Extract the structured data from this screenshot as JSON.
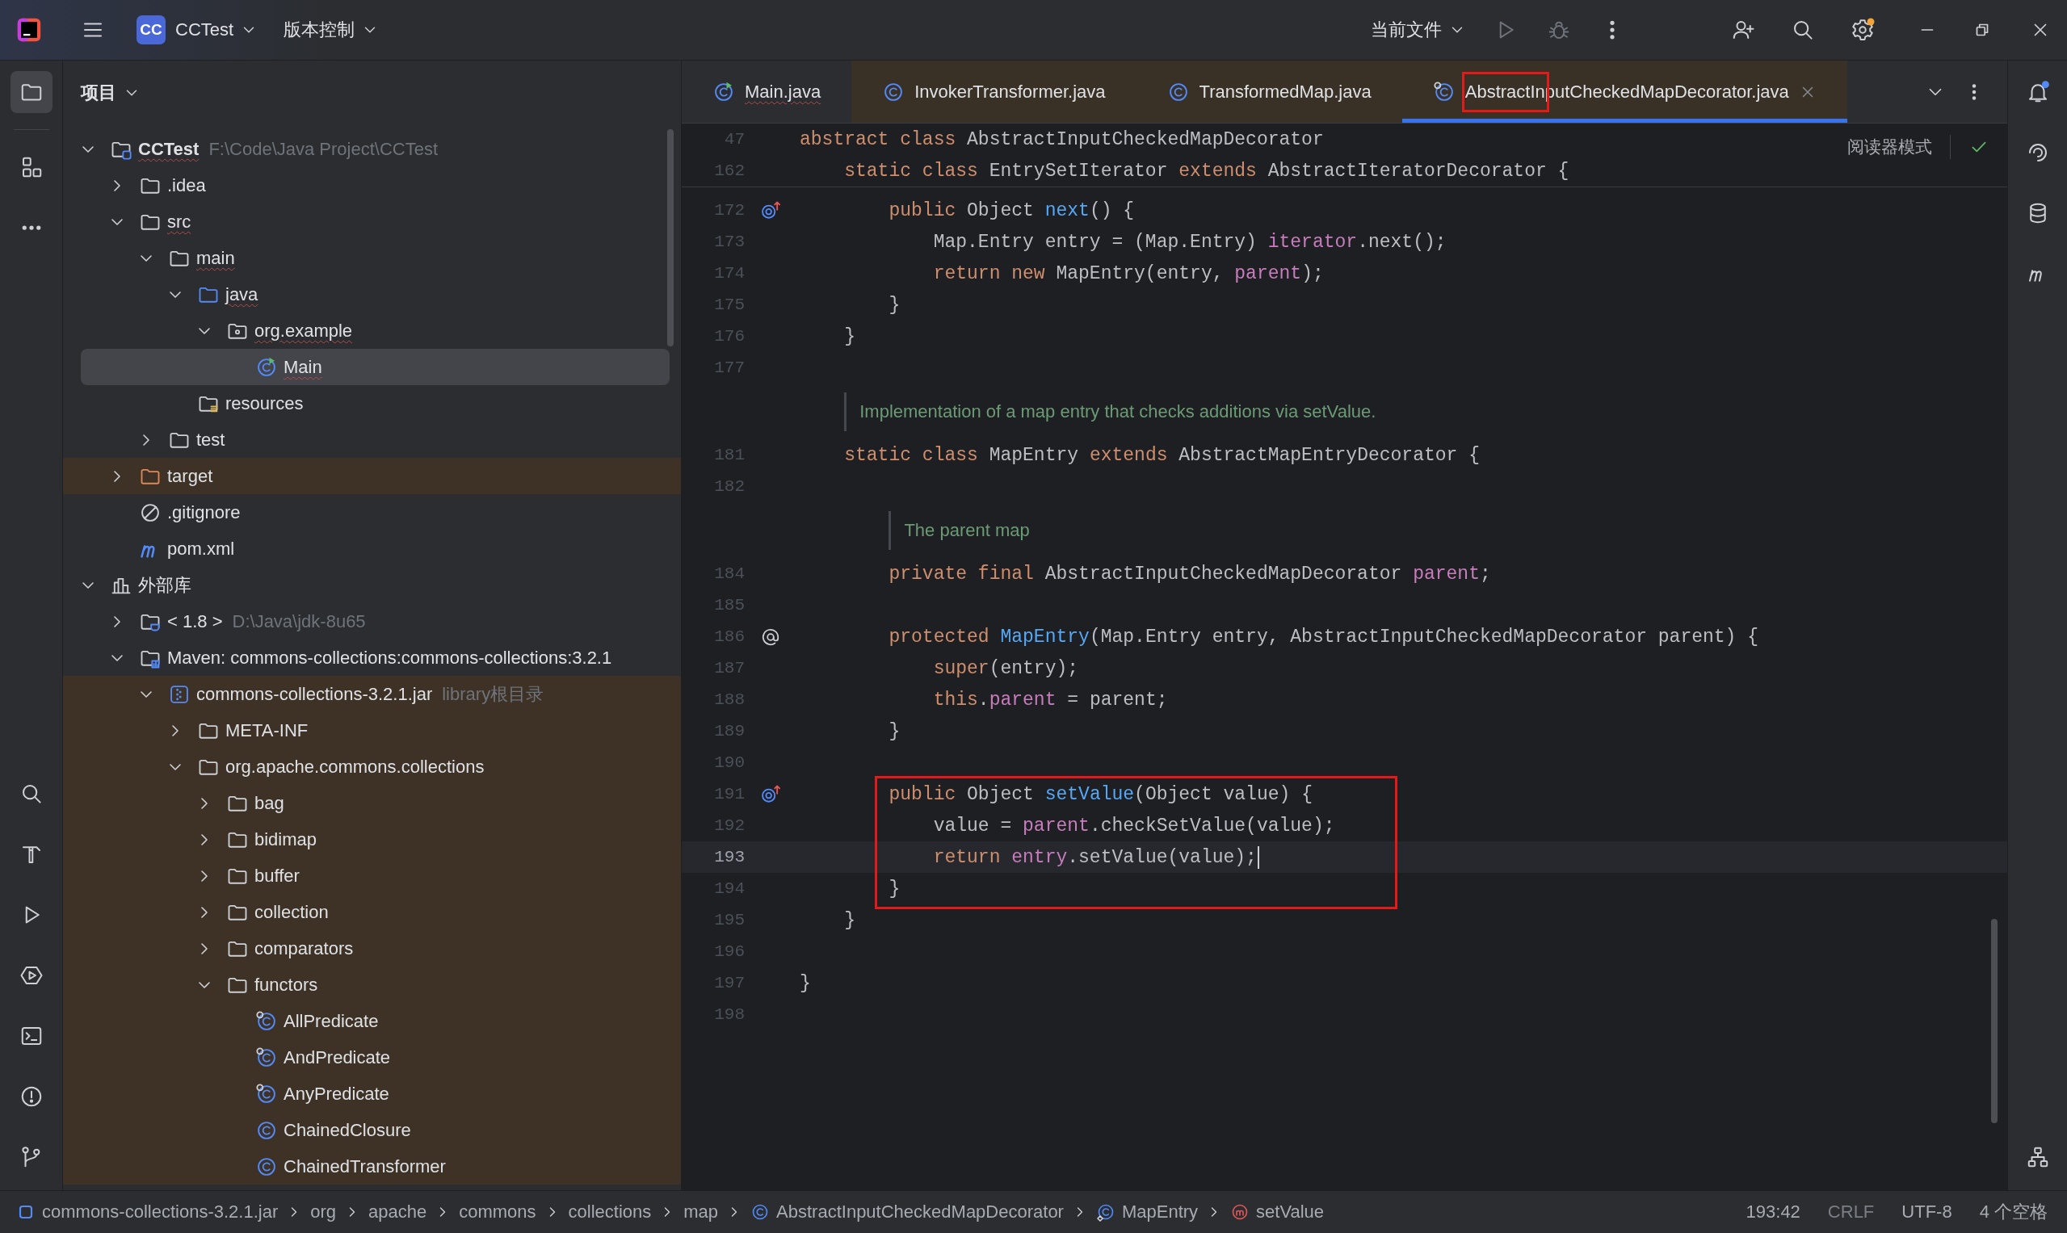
{
  "topbar": {
    "project_badge": "CC",
    "project": "CCTest",
    "vcs": "版本控制",
    "run_config": "当前文件",
    "run_enabled": false,
    "debug_enabled": false,
    "settings_badge": true
  },
  "left_tools": {
    "top": [
      {
        "kind": "project",
        "selected": true
      },
      {
        "kind": "structure",
        "selected": false
      },
      {
        "kind": "more",
        "selected": false
      }
    ],
    "bottom": [
      {
        "kind": "search",
        "selected": false
      },
      {
        "kind": "build",
        "selected": false
      },
      {
        "kind": "run",
        "selected": false
      },
      {
        "kind": "services",
        "selected": false
      },
      {
        "kind": "terminal",
        "selected": false
      },
      {
        "kind": "problems",
        "selected": false
      },
      {
        "kind": "git",
        "selected": false
      }
    ]
  },
  "project_panel": {
    "title": "项目",
    "tree": [
      {
        "name": "CCTest",
        "kind": "project",
        "hint": "F:\\Code\\Java Project\\CCTest",
        "expanded": true,
        "selected": false,
        "squiggly": true,
        "children": [
          {
            "name": ".idea",
            "kind": "folder",
            "expanded": false,
            "selected": false,
            "squiggly": false
          },
          {
            "name": "src",
            "kind": "folder",
            "expanded": true,
            "selected": false,
            "squiggly": true,
            "children": [
              {
                "name": "main",
                "kind": "folder",
                "expanded": true,
                "selected": false,
                "squiggly": true,
                "children": [
                  {
                    "name": "java",
                    "kind": "source_root",
                    "expanded": true,
                    "selected": false,
                    "squiggly": true,
                    "children": [
                      {
                        "name": "org.example",
                        "kind": "package",
                        "expanded": true,
                        "selected": false,
                        "squiggly": true,
                        "children": [
                          {
                            "name": "Main",
                            "kind": "class_main",
                            "selected": true,
                            "squiggly": true
                          }
                        ]
                      }
                    ]
                  },
                  {
                    "name": "resources",
                    "kind": "resources",
                    "selected": false,
                    "squiggly": false
                  }
                ]
              },
              {
                "name": "test",
                "kind": "folder",
                "expanded": false,
                "selected": false,
                "squiggly": false
              }
            ]
          },
          {
            "name": "target",
            "kind": "excluded",
            "expanded": false,
            "selected": false,
            "squiggly": false
          },
          {
            "name": ".gitignore",
            "kind": "ignore_file",
            "selected": false,
            "squiggly": false
          },
          {
            "name": "pom.xml",
            "kind": "maven_file",
            "selected": false,
            "squiggly": false
          }
        ]
      },
      {
        "name": "外部库",
        "kind": "libraries",
        "expanded": true,
        "selected": false,
        "squiggly": false,
        "children": [
          {
            "name": "< 1.8 >",
            "kind": "sdk",
            "hint": "D:\\Java\\jdk-8u65",
            "expanded": false,
            "selected": false,
            "squiggly": false
          },
          {
            "name": "Maven: commons-collections:commons-collections:3.2.1",
            "kind": "maven_lib",
            "expanded": true,
            "selected": false,
            "squiggly": false,
            "children": [
              {
                "name": "commons-collections-3.2.1.jar",
                "kind": "jar",
                "hint": "library根目录",
                "expanded": true,
                "selected": false,
                "squiggly": false,
                "children": [
                  {
                    "name": "META-INF",
                    "kind": "folder",
                    "expanded": false,
                    "selected": false,
                    "squiggly": false
                  },
                  {
                    "name": "org.apache.commons.collections",
                    "kind": "folder",
                    "expanded": true,
                    "selected": false,
                    "squiggly": false,
                    "children": [
                      {
                        "name": "bag",
                        "kind": "folder",
                        "expanded": false,
                        "selected": false,
                        "squiggly": false
                      },
                      {
                        "name": "bidimap",
                        "kind": "folder",
                        "expanded": false,
                        "selected": false,
                        "squiggly": false
                      },
                      {
                        "name": "buffer",
                        "kind": "folder",
                        "expanded": false,
                        "selected": false,
                        "squiggly": false
                      },
                      {
                        "name": "collection",
                        "kind": "folder",
                        "expanded": false,
                        "selected": false,
                        "squiggly": false
                      },
                      {
                        "name": "comparators",
                        "kind": "folder",
                        "expanded": false,
                        "selected": false,
                        "squiggly": false
                      },
                      {
                        "name": "functors",
                        "kind": "folder",
                        "expanded": true,
                        "selected": false,
                        "squiggly": false,
                        "children": [
                          {
                            "name": "AllPredicate",
                            "kind": "class_lib",
                            "selected": false,
                            "squiggly": false
                          },
                          {
                            "name": "AndPredicate",
                            "kind": "class_lib",
                            "selected": false,
                            "squiggly": false
                          },
                          {
                            "name": "AnyPredicate",
                            "kind": "class_lib",
                            "selected": false,
                            "squiggly": false
                          },
                          {
                            "name": "ChainedClosure",
                            "kind": "class",
                            "selected": false,
                            "squiggly": false
                          },
                          {
                            "name": "ChainedTransformer",
                            "kind": "class",
                            "selected": false,
                            "squiggly": false
                          }
                        ]
                      }
                    ]
                  }
                ]
              }
            ]
          }
        ]
      }
    ]
  },
  "editor": {
    "tabs": [
      {
        "label": "Main.java",
        "kind": "class_main",
        "selected": false,
        "library": false,
        "squiggly": true,
        "boxed": false
      },
      {
        "label": "InvokerTransformer.java",
        "kind": "class",
        "selected": false,
        "library": true,
        "squiggly": false,
        "boxed": false
      },
      {
        "label": "TransformedMap.java",
        "kind": "class",
        "selected": false,
        "library": true,
        "squiggly": false,
        "boxed": false
      },
      {
        "label": "AbstractInputCheckedMapDecorator.java",
        "kind": "class_lib",
        "selected": true,
        "library": true,
        "squiggly": false,
        "boxed": true
      }
    ],
    "reader_mode": "阅读器模式",
    "inspections_passed": true,
    "sticky_lines": [
      {
        "num": "47",
        "code": [
          {
            "kind": "keyword",
            "text": "abstract class "
          },
          {
            "kind": "plain",
            "text": "AbstractInputCheckedMapDecorator"
          }
        ]
      },
      {
        "num": "162",
        "code": [
          {
            "kind": "keyword",
            "text": "    static class "
          },
          {
            "kind": "plain",
            "text": "EntrySetIterator "
          },
          {
            "kind": "keyword",
            "text": "extends "
          },
          {
            "kind": "plain",
            "text": "AbstractIteratorDecorator {"
          }
        ]
      }
    ],
    "lines": [
      {
        "num": "172",
        "gutter": {
          "kind": "override"
        },
        "current": false,
        "boxed": false,
        "code": [
          {
            "kind": "keyword",
            "text": "        public "
          },
          {
            "kind": "plain",
            "text": "Object "
          },
          {
            "kind": "function",
            "text": "next"
          },
          {
            "kind": "plain",
            "text": "() {"
          }
        ]
      },
      {
        "num": "173",
        "current": false,
        "boxed": false,
        "code": [
          {
            "kind": "plain",
            "text": "            Map.Entry entry = (Map.Entry) "
          },
          {
            "kind": "field",
            "text": "iterator"
          },
          {
            "kind": "plain",
            "text": ".next();"
          }
        ]
      },
      {
        "num": "174",
        "current": false,
        "boxed": false,
        "code": [
          {
            "kind": "keyword",
            "text": "            return new "
          },
          {
            "kind": "plain",
            "text": "MapEntry(entry, "
          },
          {
            "kind": "field",
            "text": "parent"
          },
          {
            "kind": "plain",
            "text": ");"
          }
        ]
      },
      {
        "num": "175",
        "current": false,
        "boxed": false,
        "code": [
          {
            "kind": "plain",
            "text": "        }"
          }
        ]
      },
      {
        "num": "176",
        "current": false,
        "boxed": false,
        "code": [
          {
            "kind": "plain",
            "text": "    }"
          }
        ]
      },
      {
        "num": "177",
        "current": false,
        "boxed": false
      },
      {
        "num": "181",
        "doc": "Implementation of a map entry that checks additions via setValue.",
        "current": false,
        "boxed": false,
        "code": [
          {
            "kind": "keyword",
            "text": "    static class "
          },
          {
            "kind": "plain",
            "text": "MapEntry "
          },
          {
            "kind": "keyword",
            "text": "extends "
          },
          {
            "kind": "plain",
            "text": "AbstractMapEntryDecorator {"
          }
        ]
      },
      {
        "num": "182",
        "current": false,
        "boxed": false
      },
      {
        "num": "184",
        "doc": "The parent map",
        "current": false,
        "boxed": false,
        "code": [
          {
            "kind": "keyword",
            "text": "        private final "
          },
          {
            "kind": "plain",
            "text": "AbstractInputCheckedMapDecorator "
          },
          {
            "kind": "field",
            "text": "parent"
          },
          {
            "kind": "plain",
            "text": ";"
          }
        ]
      },
      {
        "num": "185",
        "current": false,
        "boxed": false
      },
      {
        "num": "186",
        "gutter": {
          "kind": "annotation"
        },
        "current": false,
        "boxed": false,
        "code": [
          {
            "kind": "keyword",
            "text": "        protected "
          },
          {
            "kind": "function",
            "text": "MapEntry"
          },
          {
            "kind": "plain",
            "text": "(Map.Entry entry, AbstractInputCheckedMapDecorator parent) {"
          }
        ]
      },
      {
        "num": "187",
        "current": false,
        "boxed": false,
        "code": [
          {
            "kind": "keyword",
            "text": "            super"
          },
          {
            "kind": "plain",
            "text": "(entry);"
          }
        ]
      },
      {
        "num": "188",
        "current": false,
        "boxed": false,
        "code": [
          {
            "kind": "keyword",
            "text": "            this"
          },
          {
            "kind": "plain",
            "text": "."
          },
          {
            "kind": "field",
            "text": "parent"
          },
          {
            "kind": "plain",
            "text": " = parent;"
          }
        ]
      },
      {
        "num": "189",
        "current": false,
        "boxed": false,
        "code": [
          {
            "kind": "plain",
            "text": "        }"
          }
        ]
      },
      {
        "num": "190",
        "current": false,
        "boxed": false
      },
      {
        "num": "191",
        "gutter": {
          "kind": "override"
        },
        "current": false,
        "boxed": true,
        "code": [
          {
            "kind": "keyword",
            "text": "        public "
          },
          {
            "kind": "plain",
            "text": "Object "
          },
          {
            "kind": "function",
            "text": "setValue"
          },
          {
            "kind": "plain",
            "text": "(Object value) {"
          }
        ]
      },
      {
        "num": "192",
        "current": false,
        "boxed": true,
        "code": [
          {
            "kind": "plain",
            "text": "            value = "
          },
          {
            "kind": "field",
            "text": "parent"
          },
          {
            "kind": "plain",
            "text": ".checkSetValue(value);"
          }
        ]
      },
      {
        "num": "193",
        "current": true,
        "boxed": true,
        "code": [
          {
            "kind": "keyword",
            "text": "            return "
          },
          {
            "kind": "field",
            "text": "entry"
          },
          {
            "kind": "plain",
            "text": ".setValue(value);"
          }
        ]
      },
      {
        "num": "194",
        "current": false,
        "boxed": true,
        "code": [
          {
            "kind": "plain",
            "text": "        }"
          }
        ]
      },
      {
        "num": "195",
        "current": false,
        "boxed": false,
        "code": [
          {
            "kind": "plain",
            "text": "    }"
          }
        ]
      },
      {
        "num": "196",
        "current": false,
        "boxed": false
      },
      {
        "num": "197",
        "current": false,
        "boxed": false,
        "code": [
          {
            "kind": "plain",
            "text": "}"
          }
        ]
      },
      {
        "num": "198",
        "current": false,
        "boxed": false
      }
    ]
  },
  "right_tools": {
    "top": [
      {
        "kind": "notifications",
        "selected": false
      },
      {
        "kind": "ai",
        "selected": false
      },
      {
        "kind": "database",
        "selected": false
      },
      {
        "kind": "maven",
        "selected": false
      }
    ],
    "bottom": [
      {
        "kind": "hierarchy",
        "selected": false
      }
    ],
    "notifications_unread": true
  },
  "status_bar": {
    "breadcrumbs": [
      {
        "label": "commons-collections-3.2.1.jar",
        "kind": "jar"
      },
      {
        "label": "org",
        "kind": "package"
      },
      {
        "label": "apache",
        "kind": "package"
      },
      {
        "label": "commons",
        "kind": "package"
      },
      {
        "label": "collections",
        "kind": "package"
      },
      {
        "label": "map",
        "kind": "package"
      },
      {
        "label": "AbstractInputCheckedMapDecorator",
        "kind": "class"
      },
      {
        "label": "MapEntry",
        "kind": "inner_class"
      },
      {
        "label": "setValue",
        "kind": "method"
      }
    ],
    "position": "193:42",
    "line_separator": "CRLF",
    "encoding": "UTF-8",
    "indent": "4 个空格"
  }
}
